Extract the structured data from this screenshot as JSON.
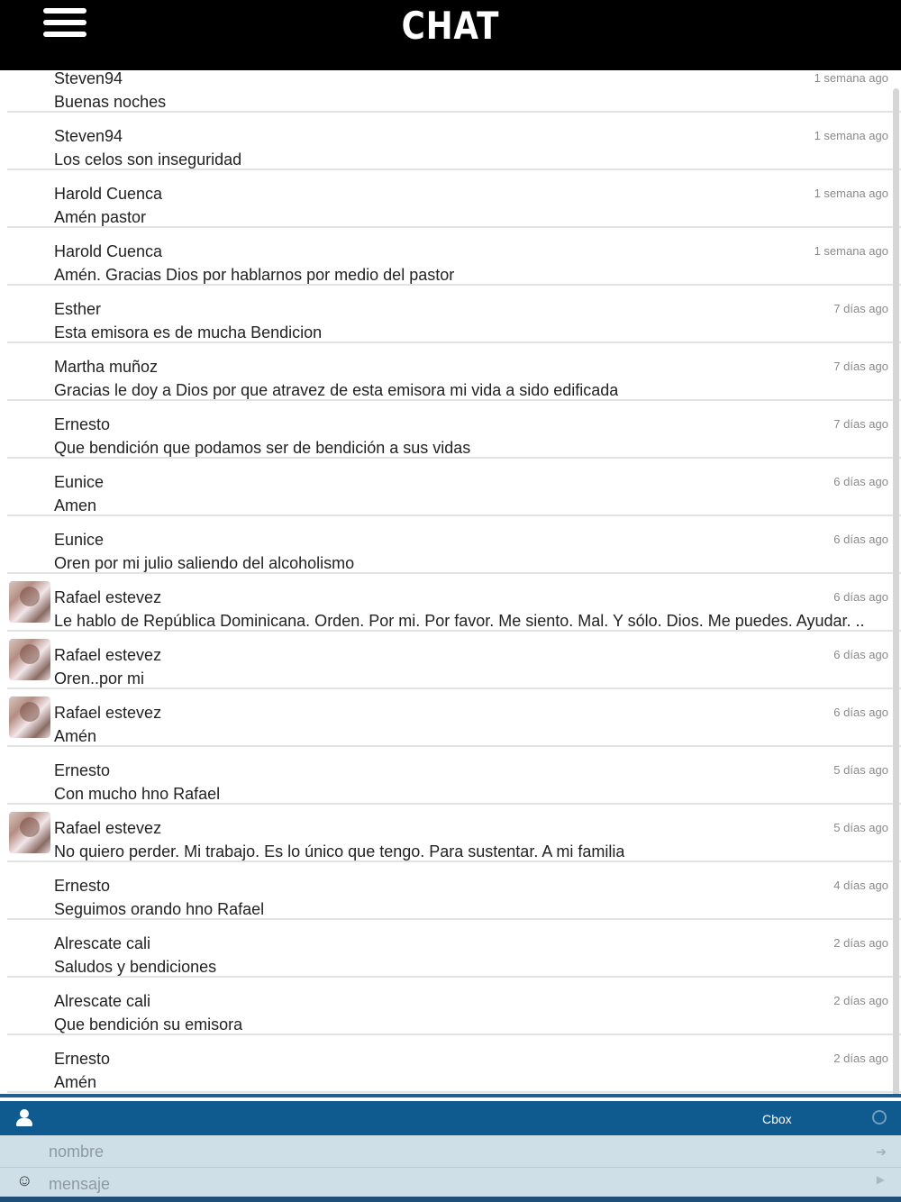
{
  "header": {
    "title": "CHAT"
  },
  "messages": [
    {
      "user": "Steven94",
      "text": "Buenas noches",
      "time": "1 semana ago",
      "avatar": false
    },
    {
      "user": "Steven94",
      "text": "Los celos son inseguridad",
      "time": "1 semana ago",
      "avatar": false
    },
    {
      "user": "Harold Cuenca",
      "text": "Amén pastor",
      "time": "1 semana ago",
      "avatar": false
    },
    {
      "user": "Harold Cuenca",
      "text": "Amén. Gracias Dios por hablarnos por medio del pastor",
      "time": "1 semana ago",
      "avatar": false
    },
    {
      "user": "Esther",
      "text": "Esta emisora es de mucha Bendicion",
      "time": "7 días ago",
      "avatar": false
    },
    {
      "user": "Martha muñoz",
      "text": "Gracias le doy a Dios por que atravez de esta emisora mi vida a sido edificada",
      "time": "7 días ago",
      "avatar": false
    },
    {
      "user": "Ernesto",
      "text": "Que bendición que podamos ser de bendición a sus vidas",
      "time": "7 días ago",
      "avatar": false
    },
    {
      "user": "Eunice",
      "text": "Amen",
      "time": "6 días ago",
      "avatar": false
    },
    {
      "user": "Eunice",
      "text": "Oren por mi julio saliendo del alcoholismo",
      "time": "6 días ago",
      "avatar": false
    },
    {
      "user": "Rafael estevez",
      "text": "Le hablo de República Dominicana. Orden. Por mi. Por favor. Me siento. Mal. Y sólo. Dios. Me puedes. Ayudar. ..",
      "time": "6 días ago",
      "avatar": true
    },
    {
      "user": "Rafael estevez",
      "text": "Oren..por mi",
      "time": "6 días ago",
      "avatar": true
    },
    {
      "user": "Rafael estevez",
      "text": "Amén",
      "time": "6 días ago",
      "avatar": true
    },
    {
      "user": "Ernesto",
      "text": "Con mucho hno Rafael",
      "time": "5 días ago",
      "avatar": false
    },
    {
      "user": "Rafael estevez",
      "text": "No quiero perder. Mi trabajo. Es lo único que tengo. Para sustentar. A mi familia",
      "time": "5 días ago",
      "avatar": true
    },
    {
      "user": "Ernesto",
      "text": "Seguimos orando hno Rafael",
      "time": "4 días ago",
      "avatar": false
    },
    {
      "user": "Alrescate cali",
      "text": "Saludos y bendiciones",
      "time": "2 días ago",
      "avatar": false
    },
    {
      "user": "Alrescate cali",
      "text": "Que bendición su emisora",
      "time": "2 días ago",
      "avatar": false
    },
    {
      "user": "Ernesto",
      "text": "Amén",
      "time": "2 días ago",
      "avatar": false
    }
  ],
  "footer": {
    "brand": "Cbox",
    "name_placeholder": "nombre",
    "message_placeholder": "mensaje"
  },
  "icons": {
    "menu": "hamburger-menu-icon",
    "user": "user-icon",
    "status": "status-circle-icon",
    "login": "login-icon",
    "emoji": "smile-icon",
    "send": "send-icon"
  },
  "colors": {
    "header_bg": "#000000",
    "footer_bar": "#0f5a8f",
    "input_bg": "#cfdfe8"
  }
}
